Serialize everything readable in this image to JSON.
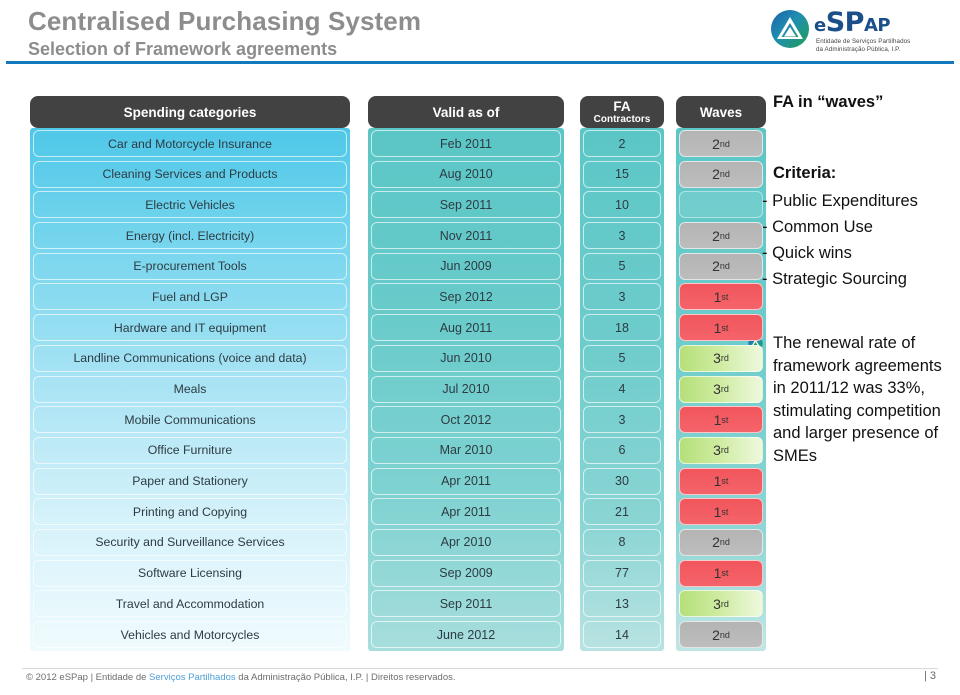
{
  "header": {
    "title": "Centralised Purchasing System",
    "subtitle": "Selection of Framework agreements",
    "rule_color": "#1179be"
  },
  "logo": {
    "wordmark_prefix": "e",
    "wordmark_main": "SP",
    "wordmark_suffix": "AP",
    "tagline_line1": "Entidade de Serviços Partilhados",
    "tagline_line2": "da Administração Pública, I.P.",
    "mark_icon": "espap-triangle-logo-icon"
  },
  "table": {
    "columns": [
      {
        "id": "category",
        "label": "Spending categories",
        "sublabel": ""
      },
      {
        "id": "valid",
        "label": "Valid as of",
        "sublabel": ""
      },
      {
        "id": "contractors",
        "label": "FA",
        "sublabel": "Contractors"
      },
      {
        "id": "waves",
        "label": "Waves",
        "sublabel": ""
      }
    ],
    "rows": [
      {
        "category": "Car and Motorcycle Insurance",
        "valid": "Feb 2011",
        "contractors": "2",
        "wave": "2",
        "wave_suffix": "nd",
        "wave_class": "w-2nd"
      },
      {
        "category": "Cleaning Services and Products",
        "valid": "Aug 2010",
        "contractors": "15",
        "wave": "2",
        "wave_suffix": "nd",
        "wave_class": "w-2nd"
      },
      {
        "category": "Electric Vehicles",
        "valid": "Sep 2011",
        "contractors": "10",
        "wave": "",
        "wave_suffix": "",
        "wave_class": "w-none"
      },
      {
        "category": "Energy (incl. Electricity)",
        "valid": "Nov 2011",
        "contractors": "3",
        "wave": "2",
        "wave_suffix": "nd",
        "wave_class": "w-2nd"
      },
      {
        "category": "E-procurement Tools",
        "valid": "Jun 2009",
        "contractors": "5",
        "wave": "2",
        "wave_suffix": "nd",
        "wave_class": "w-2nd"
      },
      {
        "category": "Fuel and LGP",
        "valid": "Sep 2012",
        "contractors": "3",
        "wave": "1",
        "wave_suffix": "st",
        "wave_class": "w-1st"
      },
      {
        "category": "Hardware and IT equipment",
        "valid": "Aug 2011",
        "contractors": "18",
        "wave": "1",
        "wave_suffix": "st",
        "wave_class": "w-1st"
      },
      {
        "category": "Landline Communications (voice and data)",
        "valid": "Jun 2010",
        "contractors": "5",
        "wave": "3",
        "wave_suffix": "rd",
        "wave_class": "w-3rd"
      },
      {
        "category": "Meals",
        "valid": "Jul 2010",
        "contractors": "4",
        "wave": "3",
        "wave_suffix": "rd",
        "wave_class": "w-3rd"
      },
      {
        "category": "Mobile Communications",
        "valid": "Oct 2012",
        "contractors": "3",
        "wave": "1",
        "wave_suffix": "st",
        "wave_class": "w-1st"
      },
      {
        "category": "Office Furniture",
        "valid": "Mar 2010",
        "contractors": "6",
        "wave": "3",
        "wave_suffix": "rd",
        "wave_class": "w-3rd"
      },
      {
        "category": "Paper and Stationery",
        "valid": "Apr 2011",
        "contractors": "30",
        "wave": "1",
        "wave_suffix": "st",
        "wave_class": "w-1st"
      },
      {
        "category": "Printing and Copying",
        "valid": "Apr 2011",
        "contractors": "21",
        "wave": "1",
        "wave_suffix": "st",
        "wave_class": "w-1st"
      },
      {
        "category": "Security and Surveillance Services",
        "valid": "Apr 2010",
        "contractors": "8",
        "wave": "2",
        "wave_suffix": "nd",
        "wave_class": "w-2nd"
      },
      {
        "category": "Software Licensing",
        "valid": "Sep 2009",
        "contractors": "77",
        "wave": "1",
        "wave_suffix": "st",
        "wave_class": "w-1st"
      },
      {
        "category": "Travel and Accommodation",
        "valid": "Sep 2011",
        "contractors": "13",
        "wave": "3",
        "wave_suffix": "rd",
        "wave_class": "w-3rd"
      },
      {
        "category": "Vehicles and Motorcycles",
        "valid": "June 2012",
        "contractors": "14",
        "wave": "2",
        "wave_suffix": "nd",
        "wave_class": "w-2nd"
      }
    ],
    "wave_colors": {
      "first": "#f2555c",
      "second": "#b4b4b4",
      "third": "#b5e07a"
    }
  },
  "panel": {
    "blocks": [
      {
        "id": "fa-waves",
        "heading": "FA in “waves”"
      },
      {
        "id": "criteria",
        "heading": "Criteria:",
        "items": [
          "- Public Expenditures",
          "- Common Use",
          "- Quick wins",
          "- Strategic Sourcing"
        ]
      },
      {
        "id": "renewal",
        "heading": "The renewal rate of framework agreements in 2011/12 was 33%, stimulating competition and larger presence of SMEs"
      }
    ]
  },
  "footer": {
    "prefix": "© 2012 eSPap | Entidade de ",
    "link": "Serviços Partilhados",
    "suffix": " da Administração Pública, I.P. | Direitos reservados.",
    "page": "| 3"
  }
}
